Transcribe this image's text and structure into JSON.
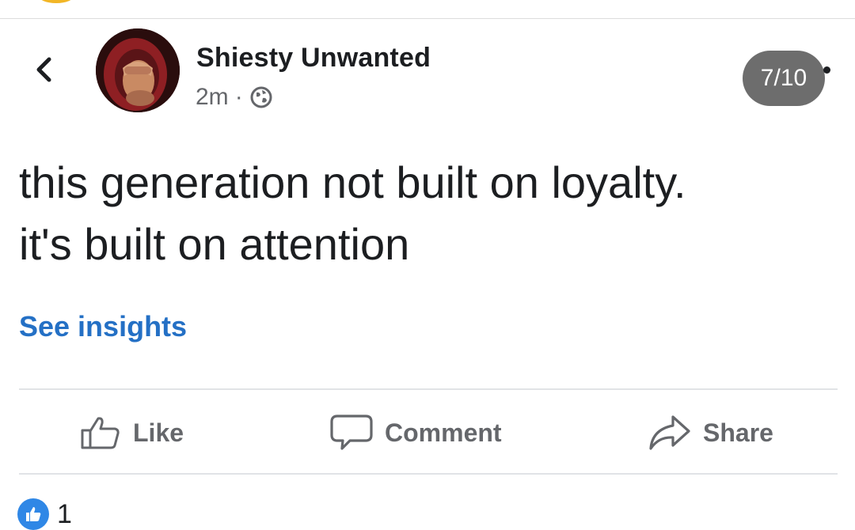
{
  "post": {
    "author": "Shiesty Unwanted",
    "time": "2m",
    "separator": "·",
    "text_lines": [
      "this generation not built on loyalty.",
      "it's built on attention"
    ],
    "insights_label": "See insights"
  },
  "viewer": {
    "counter": "7/10"
  },
  "actions": {
    "like": "Like",
    "comment": "Comment",
    "share": "Share"
  },
  "reactions": {
    "count": "1"
  },
  "colors": {
    "link_blue": "#2470c5",
    "muted_gray": "#65676b",
    "like_blue": "#2f87e6",
    "counter_bg": "#6d6d6d"
  },
  "icons": {
    "back": "chevron-left-icon",
    "privacy": "globe-icon",
    "like": "thumbs-up-icon",
    "comment": "comment-bubble-icon",
    "share": "share-arrow-icon"
  }
}
